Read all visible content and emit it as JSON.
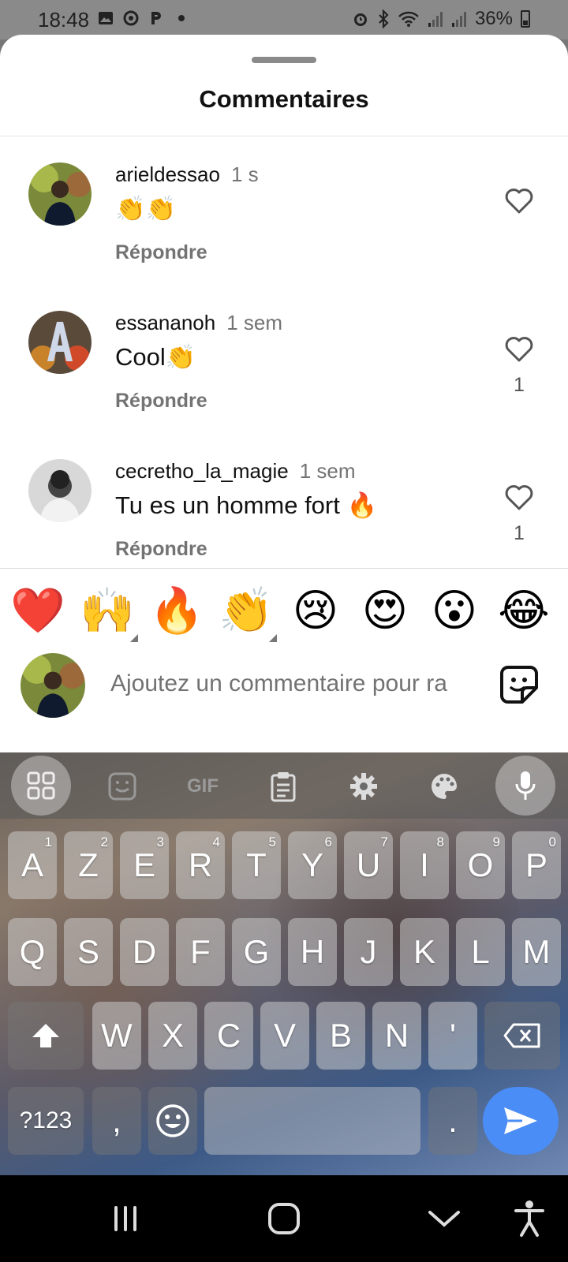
{
  "status_bar": {
    "time": "18:48",
    "left_icons": [
      "image-icon",
      "settings-circle-icon",
      "p-icon",
      "dot-icon"
    ],
    "right_icons": [
      "alarm-icon",
      "bluetooth-icon",
      "wifi-icon",
      "signal-icon",
      "signal-icon"
    ],
    "battery": "36%"
  },
  "sheet": {
    "title": "Commentaires",
    "comments": [
      {
        "username": "arieldessao",
        "time": "1 s",
        "text": "👏👏",
        "reply_label": "Répondre",
        "likes": ""
      },
      {
        "username": "essananoh",
        "time": "1 sem",
        "text": "Cool👏",
        "reply_label": "Répondre",
        "likes": "1"
      },
      {
        "username": "cecretho_la_magie",
        "time": "1 sem",
        "text": "Tu es un homme fort 🔥",
        "reply_label": "Répondre",
        "likes": "1"
      }
    ],
    "quick_emojis": [
      "❤️",
      "🙌",
      "🔥",
      "👏",
      "😢",
      "😍",
      "😮",
      "😂"
    ],
    "composer": {
      "placeholder": "Ajoutez un commentaire pour ra"
    }
  },
  "keyboard": {
    "toolbar": [
      "apps-grid-icon",
      "sticker-icon",
      "gif-icon",
      "clipboard-icon",
      "gear-icon",
      "palette-icon",
      "mic-icon"
    ],
    "gif_label": "GIF",
    "row1": [
      "A",
      "Z",
      "E",
      "R",
      "T",
      "Y",
      "U",
      "I",
      "O",
      "P"
    ],
    "row1_sup": [
      "1",
      "2",
      "3",
      "4",
      "5",
      "6",
      "7",
      "8",
      "9",
      "0"
    ],
    "row2": [
      "Q",
      "S",
      "D",
      "F",
      "G",
      "H",
      "J",
      "K",
      "L",
      "M"
    ],
    "row3": [
      "W",
      "X",
      "C",
      "V",
      "B",
      "N",
      "'"
    ],
    "symbols_label": "?123",
    "comma": ",",
    "period": "."
  },
  "nav_bar": [
    "recents-icon",
    "home-icon",
    "back-chevron-icon",
    "accessibility-icon"
  ]
}
